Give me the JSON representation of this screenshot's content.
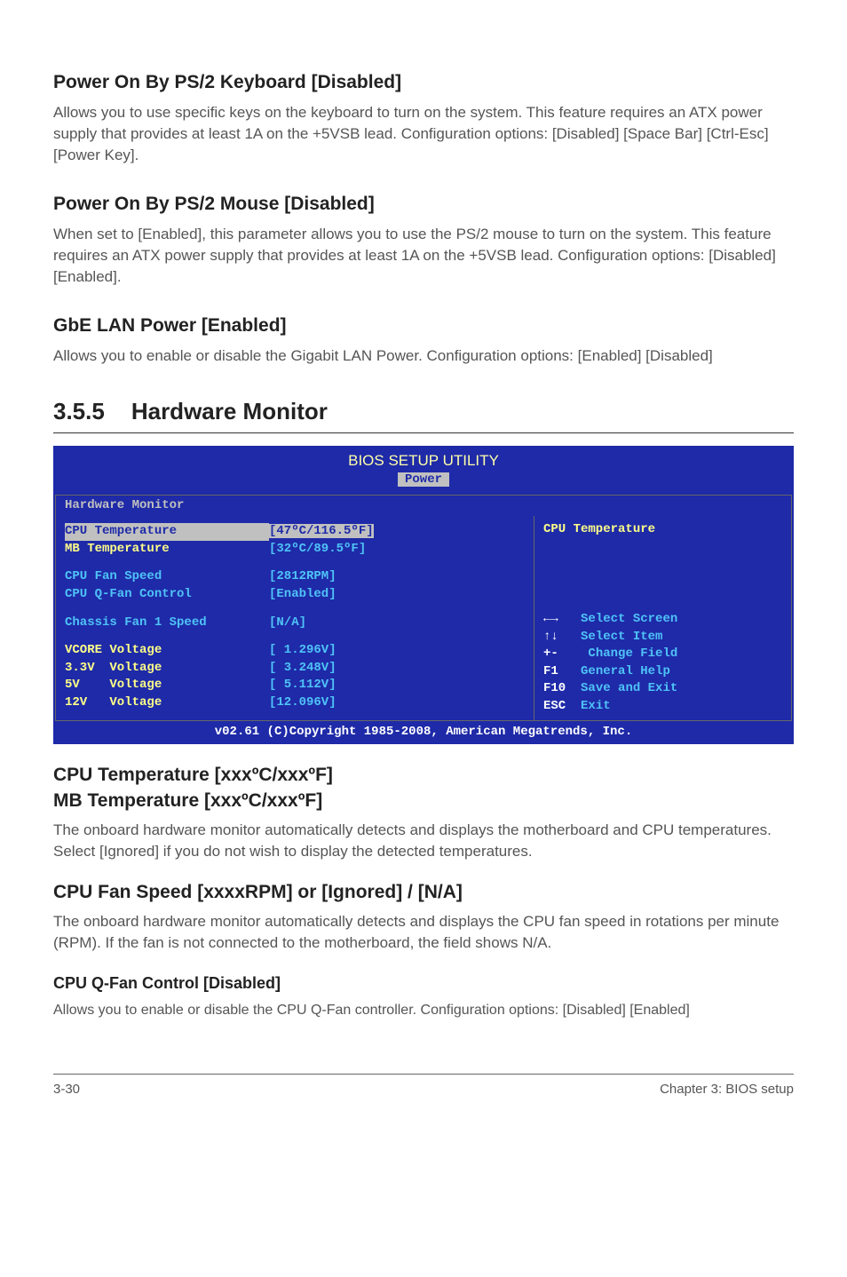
{
  "sections": {
    "s1": {
      "title": "Power On By PS/2 Keyboard [Disabled]",
      "body": "Allows you to use specific keys on the keyboard to turn on the system. This feature requires an ATX power supply that provides at least 1A on the +5VSB lead. Configuration options: [Disabled] [Space Bar] [Ctrl-Esc] [Power Key]."
    },
    "s2": {
      "title": "Power On By PS/2 Mouse [Disabled]",
      "body": "When set to [Enabled], this parameter allows you to use the PS/2 mouse to turn on the system. This feature requires an ATX power supply that provides at least 1A on the +5VSB lead. Configuration options: [Disabled] [Enabled]."
    },
    "s3": {
      "title": "GbE LAN Power [Enabled]",
      "body": "Allows you to enable or disable the Gigabit LAN Power. Configuration options: [Enabled] [Disabled]"
    },
    "numbered": {
      "num": "3.5.5",
      "title": "Hardware Monitor"
    },
    "temp": {
      "title1": "CPU Temperature [xxxºC/xxxºF]",
      "title2": "MB Temperature [xxxºC/xxxºF]",
      "body": "The onboard hardware monitor automatically detects and displays the motherboard and CPU temperatures. Select [Ignored] if you do not wish to display the detected temperatures."
    },
    "fan": {
      "title": "CPU Fan Speed [xxxxRPM] or [Ignored] / [N/A]",
      "body": "The onboard hardware monitor automatically detects and displays the CPU fan speed in rotations per minute (RPM). If the fan is not connected to the motherboard, the field shows N/A."
    },
    "qfan": {
      "title": "CPU Q-Fan Control [Disabled]",
      "body": "Allows you to enable or disable the CPU Q-Fan controller. Configuration options: [Disabled] [Enabled]"
    }
  },
  "bios": {
    "title": "BIOS SETUP UTILITY",
    "tab": "Power",
    "subhead": "Hardware Monitor",
    "rows": {
      "cpu_temp": {
        "label": "CPU Temperature",
        "value": "[47ºC/116.5ºF]"
      },
      "mb_temp": {
        "label": "MB Temperature",
        "value": "[32ºC/89.5ºF]"
      },
      "cpu_fan": {
        "label": "CPU Fan Speed",
        "value": "[2812RPM]"
      },
      "cpu_qfan": {
        "label": "CPU Q-Fan Control",
        "value": "[Enabled]"
      },
      "chassis": {
        "label": "Chassis Fan 1 Speed",
        "value": "[N/A]"
      },
      "vcore": {
        "label": "VCORE Voltage",
        "value": "[ 1.296V]"
      },
      "v33": {
        "label": "3.3V  Voltage",
        "value": "[ 3.248V]"
      },
      "v5": {
        "label": "5V    Voltage",
        "value": "[ 5.112V]"
      },
      "v12": {
        "label": "12V   Voltage",
        "value": "[12.096V]"
      }
    },
    "right_title": "CPU Temperature",
    "nav": {
      "select_screen": "Select Screen",
      "select_item": "Select Item",
      "change_field": " Change Field",
      "general_help": "General Help",
      "save_exit": "Save and Exit",
      "exit": "Exit",
      "k_lr": "←→",
      "k_ud": "↑↓",
      "k_pm": "+-",
      "k_f1": "F1",
      "k_f10": "F10",
      "k_esc": "ESC"
    },
    "footer": "v02.61 (C)Copyright 1985-2008, American Megatrends, Inc."
  },
  "page_footer": {
    "left": "3-30",
    "right": "Chapter 3: BIOS setup"
  }
}
